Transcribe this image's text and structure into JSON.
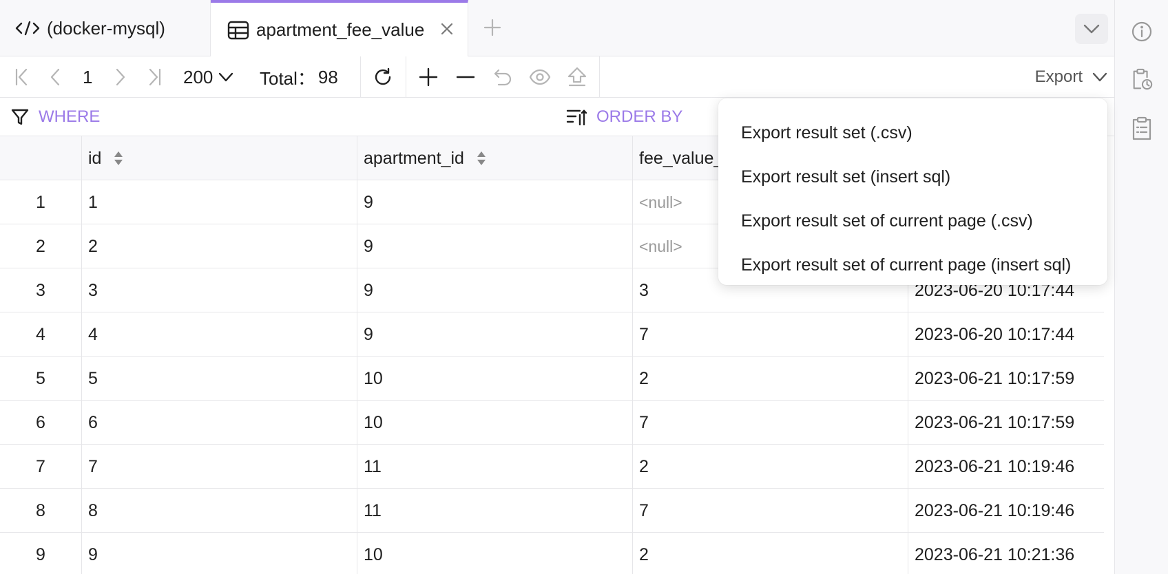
{
  "tabs": {
    "console_label": "(docker-mysql)",
    "table_label": "apartment_fee_value"
  },
  "toolbar": {
    "page_number": "1",
    "page_size": "200",
    "total_label": "Total：",
    "total_value": "98",
    "export_label": "Export"
  },
  "filter": {
    "where_label": "WHERE",
    "order_by_label": "ORDER BY"
  },
  "grid": {
    "columns": [
      "id",
      "apartment_id",
      "fee_value_",
      ""
    ],
    "rows": [
      {
        "idx": "1",
        "id": "1",
        "apartment_id": "9",
        "fee_value": "<null>",
        "time": ""
      },
      {
        "idx": "2",
        "id": "2",
        "apartment_id": "9",
        "fee_value": "<null>",
        "time": ""
      },
      {
        "idx": "3",
        "id": "3",
        "apartment_id": "9",
        "fee_value": "3",
        "time": "2023-06-20 10:17:44"
      },
      {
        "idx": "4",
        "id": "4",
        "apartment_id": "9",
        "fee_value": "7",
        "time": "2023-06-20 10:17:44"
      },
      {
        "idx": "5",
        "id": "5",
        "apartment_id": "10",
        "fee_value": "2",
        "time": "2023-06-21 10:17:59"
      },
      {
        "idx": "6",
        "id": "6",
        "apartment_id": "10",
        "fee_value": "7",
        "time": "2023-06-21 10:17:59"
      },
      {
        "idx": "7",
        "id": "7",
        "apartment_id": "11",
        "fee_value": "2",
        "time": "2023-06-21 10:19:46"
      },
      {
        "idx": "8",
        "id": "8",
        "apartment_id": "11",
        "fee_value": "7",
        "time": "2023-06-21 10:19:46"
      },
      {
        "idx": "9",
        "id": "9",
        "apartment_id": "10",
        "fee_value": "2",
        "time": "2023-06-21 10:21:36"
      }
    ]
  },
  "export_menu": {
    "items": [
      "Export result set (.csv)",
      "Export result set (insert sql)",
      "Export result set of current page (.csv)",
      "Export result set of current page (insert sql)"
    ]
  },
  "icons": {
    "console": "code-icon",
    "table": "table-icon",
    "info": "info-icon",
    "history": "clipboard-clock-icon",
    "clipboard": "clipboard-list-icon"
  },
  "colors": {
    "accent": "#9b7ae8",
    "border": "#e6e6e9",
    "null_text": "#9a9a9a"
  }
}
